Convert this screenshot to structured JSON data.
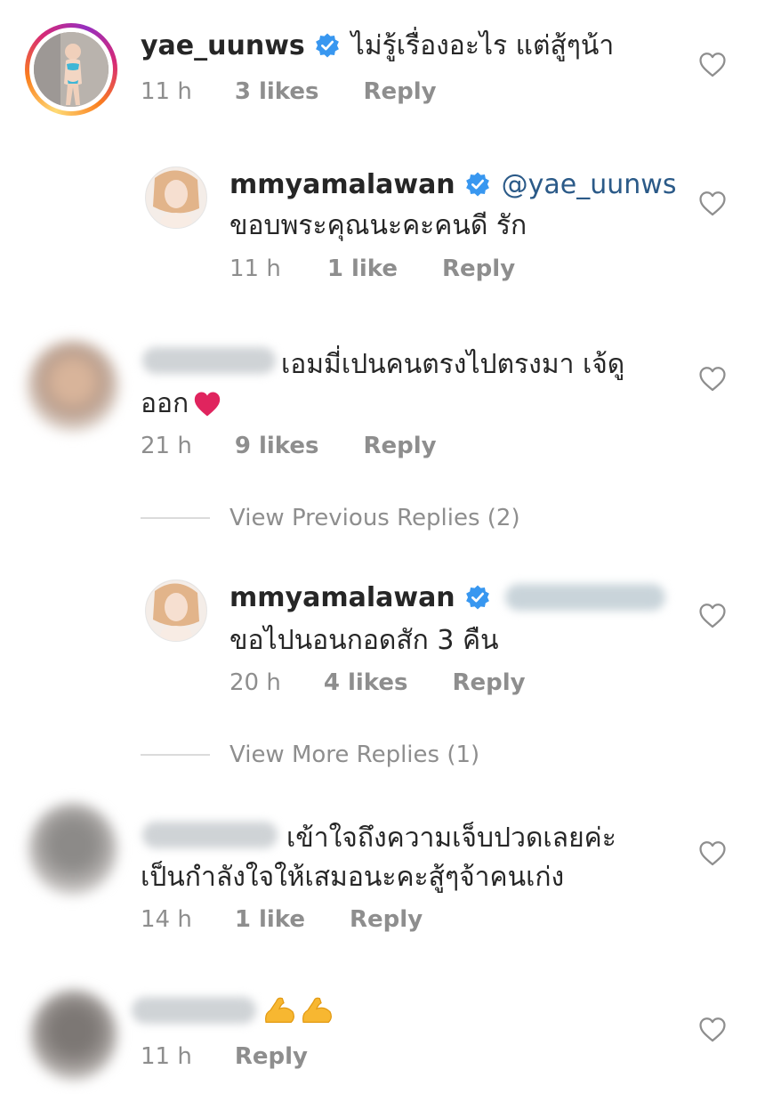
{
  "comments": [
    {
      "username": "yae_uunws",
      "text": "ไม่รู้เรื่องอะไร แต่สู้ๆน้า",
      "time": "11 h",
      "likes": "3 likes",
      "reply": "Reply"
    },
    {
      "username": "mmyamalawan",
      "mention": "@yae_uunws",
      "text": "ขอบพระคุณนะคะคนดี รัก",
      "time": "11 h",
      "likes": "1 like",
      "reply": "Reply"
    },
    {
      "text_line1": "เอมมี่เปนคนตรงไปตรงมา เจ้ดู",
      "text_line2": "ออก",
      "time": "21 h",
      "likes": "9 likes",
      "reply": "Reply"
    },
    {
      "username": "mmyamalawan",
      "text": "ขอไปนอนกอดสัก 3 คืน",
      "time": "20 h",
      "likes": "4 likes",
      "reply": "Reply"
    },
    {
      "text_line1": "เข้าใจถึงความเจ็บปวดเลยค่ะ",
      "text_line2": "เป็นกำลังใจให้เสมอนะคะสู้ๆจ้าคนเก่ง",
      "time": "14 h",
      "likes": "1 like",
      "reply": "Reply"
    },
    {
      "time": "11 h",
      "reply": "Reply"
    }
  ],
  "view_previous_replies": "View Previous Replies (2)",
  "view_more_replies": "View More Replies (1)",
  "icons": {
    "verified": "verified-badge-icon",
    "like": "heart-outline-icon",
    "emoji_heart": "red-heart-emoji",
    "emoji_muscle": "flexed-biceps-emoji"
  },
  "colors": {
    "verified_blue": "#3897f0",
    "mention_blue": "#2b5a88",
    "meta_gray": "#8e8e8e",
    "heart_red": "#e0245e",
    "emoji_yellow": "#f7b731"
  }
}
